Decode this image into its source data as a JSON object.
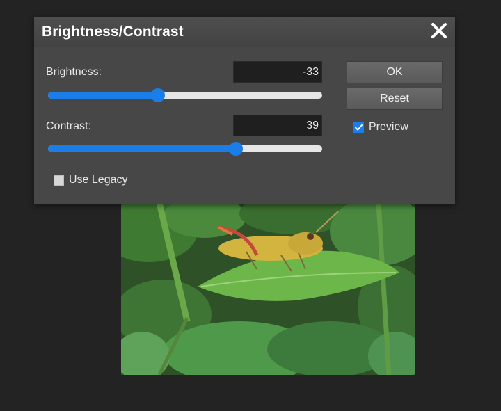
{
  "dialog": {
    "title": "Brightness/Contrast",
    "close_icon": "close-icon"
  },
  "brightness": {
    "label": "Brightness:",
    "value": "-33",
    "slider_fraction": 0.4
  },
  "contrast": {
    "label": "Contrast:",
    "value": "39",
    "slider_fraction": 0.685
  },
  "buttons": {
    "ok": "OK",
    "reset": "Reset"
  },
  "preview": {
    "label": "Preview",
    "checked": true
  },
  "use_legacy": {
    "label": "Use Legacy",
    "checked": false
  },
  "colors": {
    "accent": "#1a7de8",
    "dialog_bg": "#474747",
    "workspace_bg": "#232323"
  }
}
